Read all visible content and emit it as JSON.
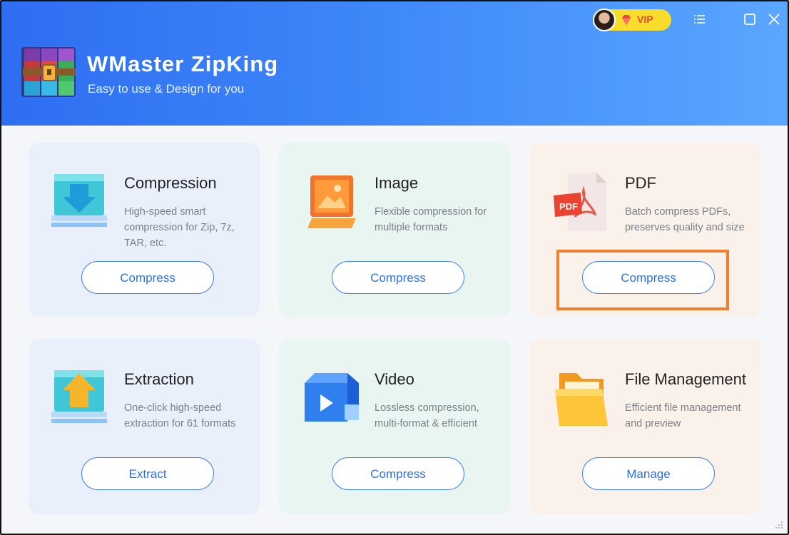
{
  "app": {
    "title": "WMaster ZipKing",
    "subtitle": "Easy to use & Design for you",
    "vip_label": "VIP"
  },
  "window_controls": [
    "menu-icon",
    "maximize-icon",
    "close-icon"
  ],
  "cards": {
    "compression": {
      "title": "Compression",
      "desc": "High-speed smart compression for Zip, 7z, TAR, etc.",
      "button": "Compress",
      "icon": "compression-tray-icon"
    },
    "image": {
      "title": "Image",
      "desc": "Flexible compression for multiple formats",
      "button": "Compress",
      "icon": "image-frame-icon"
    },
    "pdf": {
      "title": "PDF",
      "desc": "Batch compress PDFs, preserves quality and size",
      "button": "Compress",
      "icon": "pdf-file-icon"
    },
    "extraction": {
      "title": "Extraction",
      "desc": "One-click high-speed extraction for 61 formats",
      "button": "Extract",
      "icon": "extraction-tray-icon"
    },
    "video": {
      "title": "Video",
      "desc": "Lossless compression, multi-format & efficient",
      "button": "Compress",
      "icon": "video-camera-icon"
    },
    "file_management": {
      "title": "File Management",
      "desc": "Efficient file management and preview",
      "button": "Manage",
      "icon": "folder-icon"
    }
  },
  "colors": {
    "header_start": "#2e6ef2",
    "header_end": "#5aa6ff",
    "accent": "#3f82f1",
    "highlight": "#f07f2e"
  }
}
